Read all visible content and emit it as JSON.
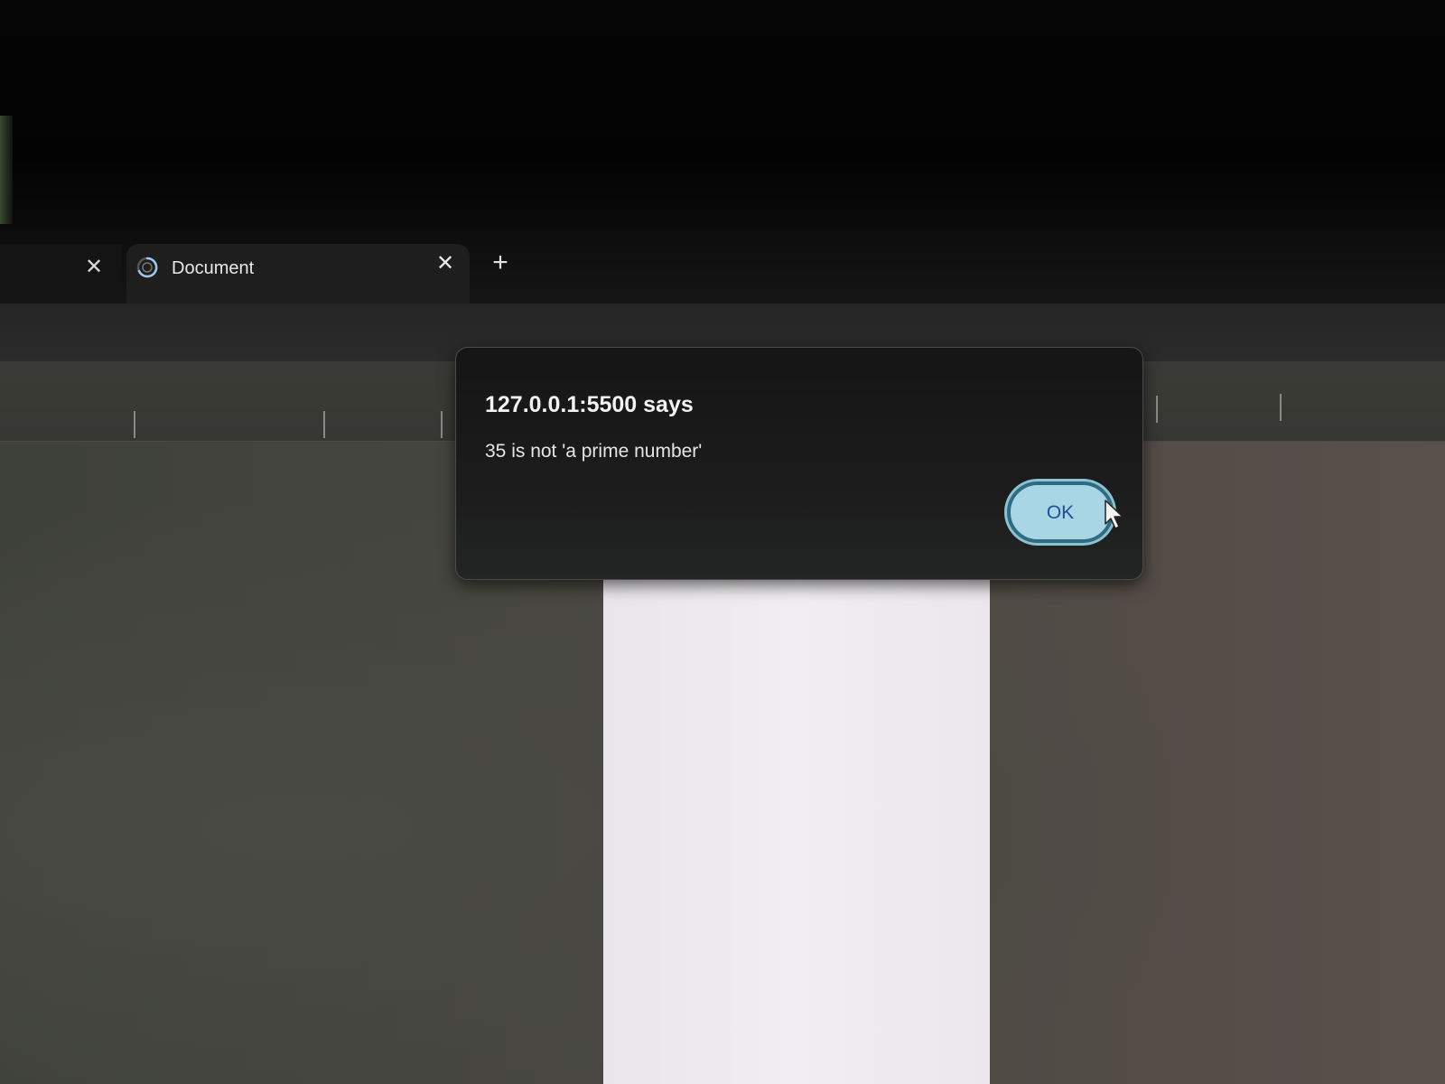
{
  "browser": {
    "tabs": [
      {
        "title": "",
        "close_glyph": "✕"
      },
      {
        "title": "Document",
        "close_glyph": "✕",
        "active": true,
        "loading": true
      }
    ],
    "new_tab_glyph": "+"
  },
  "alert": {
    "title": "127.0.0.1:5500 says",
    "message": "35 is not 'a prime number'",
    "ok_label": "OK"
  },
  "icons": {
    "tab_loading": "loading-spinner-icon",
    "close": "close-icon",
    "new_tab": "plus-icon",
    "cursor": "mouse-pointer-icon"
  },
  "colors": {
    "dialog_bg": "#1b1c1b",
    "ok_fill": "#a8d6e4",
    "ok_text": "#1f4f96",
    "ok_focus_ring": "#2f6c80"
  }
}
